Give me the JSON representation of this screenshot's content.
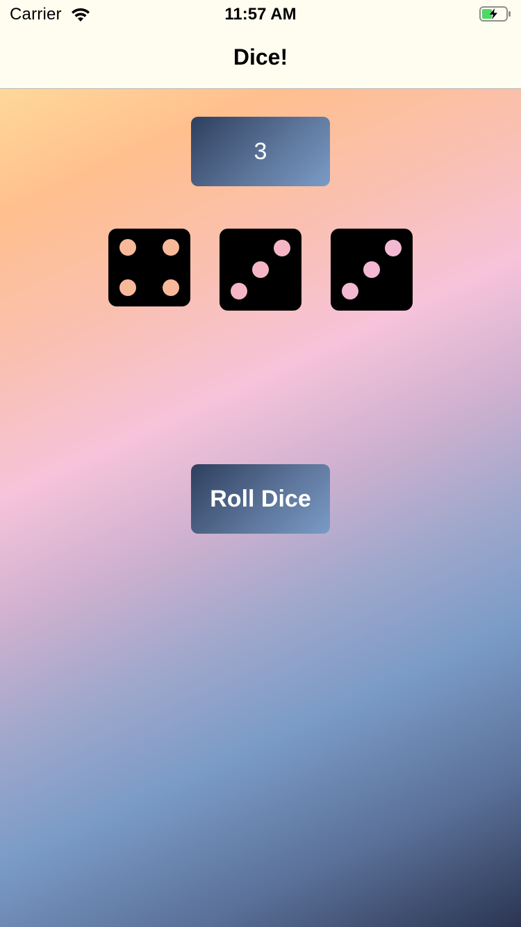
{
  "status_bar": {
    "carrier": "Carrier",
    "time": "11:57 AM",
    "wifi_icon": "wifi-icon",
    "battery_icon": "battery-charging-icon",
    "battery_color": "#4cd964"
  },
  "nav": {
    "title": "Dice!"
  },
  "score": {
    "value": "3"
  },
  "dice": [
    {
      "face": 4,
      "pip_color": "#f8b99b"
    },
    {
      "face": 3,
      "pip_color": "#f4b6c4"
    },
    {
      "face": 3,
      "pip_color": "#f3b9d3"
    }
  ],
  "actions": {
    "roll_label": "Roll Dice"
  },
  "colors": {
    "bar_background": "#fffdf0",
    "button_gradient_start": "#2e3f5e",
    "button_gradient_end": "#7a9bc7",
    "die_color": "#000000"
  }
}
